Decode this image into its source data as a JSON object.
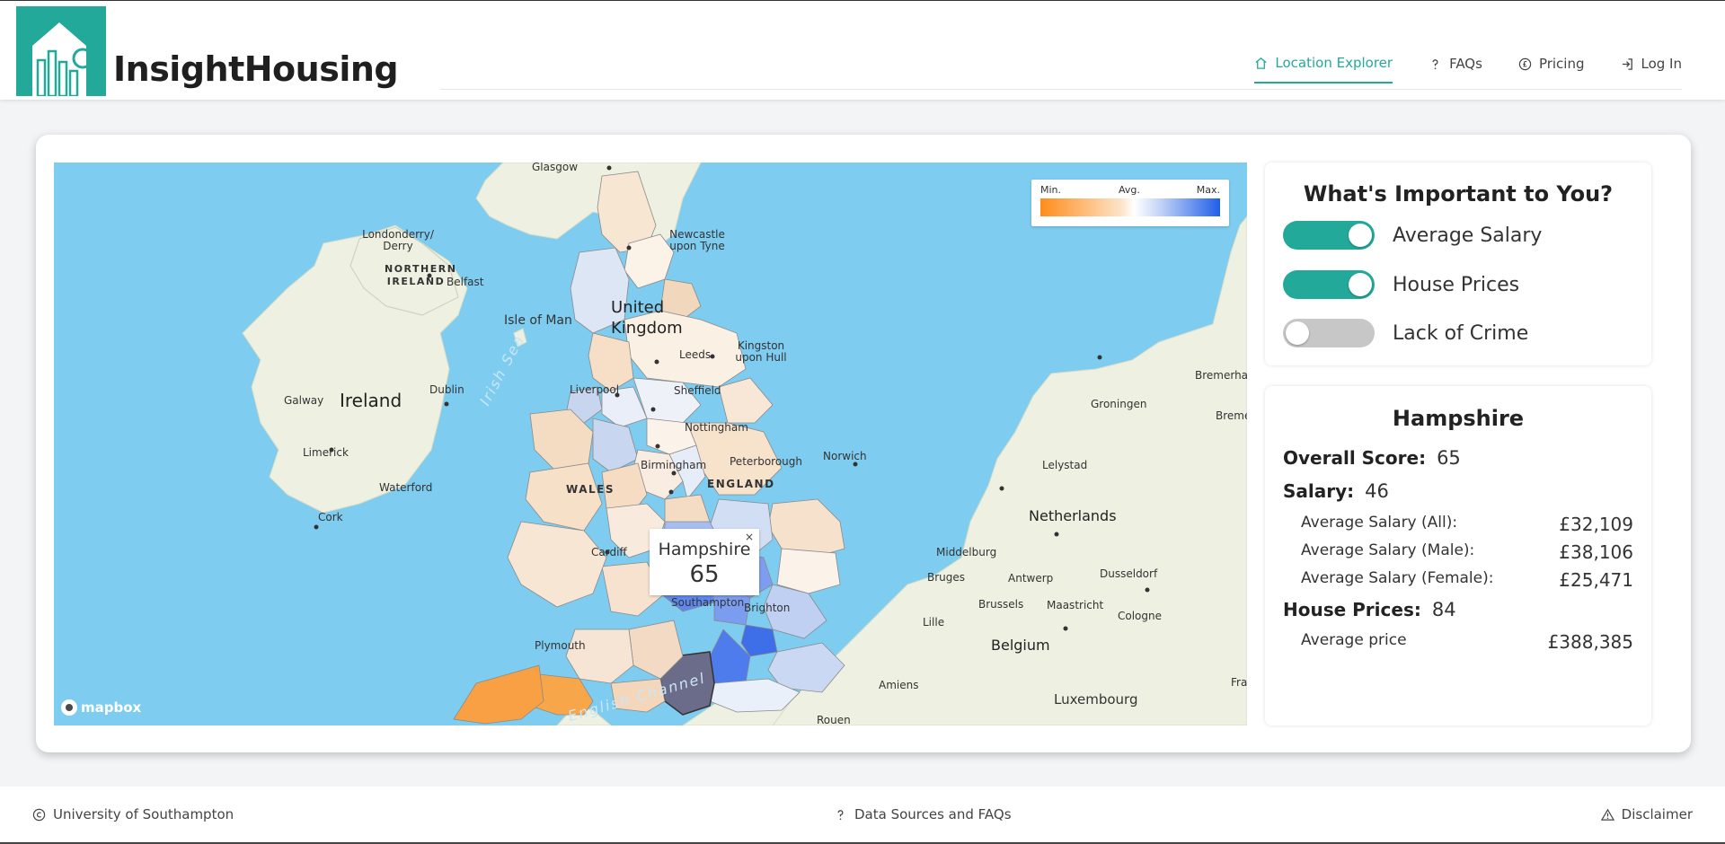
{
  "header": {
    "brand": "InsightHousing",
    "nav": [
      {
        "label": "Location Explorer",
        "icon": "home-icon",
        "active": true
      },
      {
        "label": "FAQs",
        "icon": "question-icon"
      },
      {
        "label": "Pricing",
        "icon": "pound-coin-icon"
      },
      {
        "label": "Log In",
        "icon": "login-icon"
      }
    ]
  },
  "map": {
    "legend": {
      "min": "Min.",
      "avg": "Avg.",
      "max": "Max."
    },
    "popup": {
      "title": "Hampshire",
      "value": "65",
      "close": "×"
    },
    "attribution": "mapbox",
    "labels": {
      "glasgow": "Glasgow",
      "newcastle": "Newcastle upon Tyne",
      "londonderry": "Londonderry/ Derry",
      "northern_ireland": "NORTHERN IRELAND",
      "belfast": "Belfast",
      "isle_of_man": "Isle of Man",
      "united_kingdom": "United Kingdom",
      "ireland": "Ireland",
      "galway": "Galway",
      "dublin": "Dublin",
      "irish_sea": "Irish Sea",
      "limerick": "Limerick",
      "waterford": "Waterford",
      "cork": "Cork",
      "liverpool": "Liverpool",
      "leeds": "Leeds",
      "kingston": "Kingston upon Hull",
      "sheffield": "Sheffield",
      "nottingham": "Nottingham",
      "peterborough": "Peterborough",
      "norwich": "Norwich",
      "birmingham": "Birmingham",
      "england": "ENGLAND",
      "wales": "WALES",
      "cardiff": "Cardiff",
      "southampton": "Southampton",
      "brighton": "Brighton",
      "plymouth": "Plymouth",
      "english_channel": "English Channel",
      "bremerhaven": "Bremerhaven",
      "bremen": "Breme",
      "groningen": "Groningen",
      "lelystad": "Lelystad",
      "netherlands": "Netherlands",
      "middelburg": "Middelburg",
      "bruges": "Bruges",
      "antwerp": "Antwerp",
      "dusseldorf": "Dusseldorf",
      "brussels": "Brussels",
      "maastricht": "Maastricht",
      "cologne": "Cologne",
      "lille": "Lille",
      "belgium": "Belgium",
      "amiens": "Amiens",
      "luxembourg": "Luxembourg",
      "rouen": "Rouen",
      "fra": "Fra"
    }
  },
  "preferences": {
    "title": "What's Important to You?",
    "toggles": [
      {
        "label": "Average Salary",
        "on": true
      },
      {
        "label": "House Prices",
        "on": true
      },
      {
        "label": "Lack of Crime",
        "on": false
      }
    ]
  },
  "details": {
    "title": "Hampshire",
    "overall_label": "Overall Score:",
    "overall_value": "65",
    "salary_label": "Salary:",
    "salary_value": "46",
    "salary_rows": [
      {
        "label": "Average Salary (All):",
        "value": "£32,109"
      },
      {
        "label": "Average Salary (Male):",
        "value": "£38,106"
      },
      {
        "label": "Average Salary (Female):",
        "value": "£25,471"
      }
    ],
    "house_label": "House Prices:",
    "house_value": "84",
    "house_rows": [
      {
        "label": "Average price",
        "value": "£388,385"
      }
    ]
  },
  "footer": {
    "left": "University of Southampton",
    "center": "Data Sources and FAQs",
    "right": "Disclaimer"
  },
  "colors": {
    "accent": "#22a99a",
    "sea": "#7ecdf0",
    "land": "#eef1e2",
    "min": "#ff8c1a",
    "max": "#1f5fe8"
  }
}
